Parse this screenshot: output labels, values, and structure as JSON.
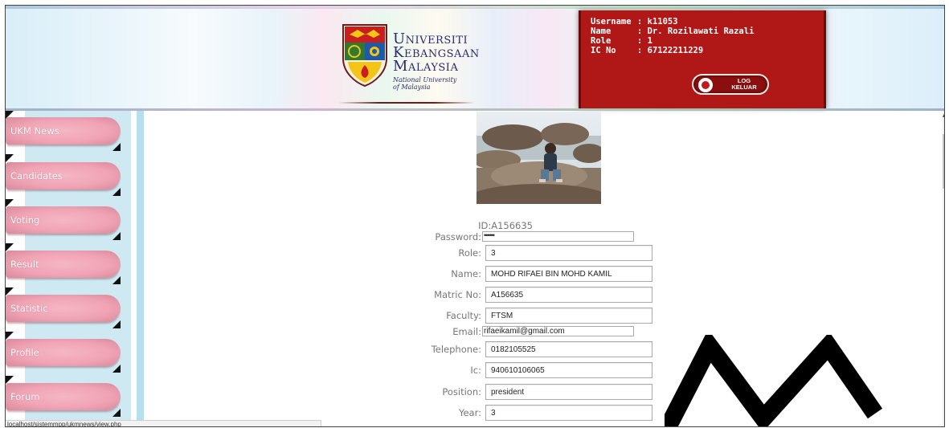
{
  "header": {
    "logo": {
      "line1_cap": "U",
      "line1_rest": "NIVERSITI",
      "line2_cap": "K",
      "line2_rest": "EBANGSAAN",
      "line3_cap": "M",
      "line3_rest": "ALAYSIA",
      "sub1": "National University",
      "sub2": "of Malaysia"
    },
    "user": {
      "username_label": "Username",
      "username_value": ": k11053",
      "name_label": "Name",
      "name_value": ": Dr. Rozilawati Razali",
      "role_label": "Role",
      "role_value": ": 1",
      "ic_label": "IC No",
      "ic_value": ": 67122211229"
    },
    "logout": {
      "line1": "LOG",
      "line2": "KELUAR"
    }
  },
  "sidebar": {
    "items": [
      {
        "label": "UKM News"
      },
      {
        "label": "Candidates"
      },
      {
        "label": "Voting"
      },
      {
        "label": "Result"
      },
      {
        "label": "Statistic"
      },
      {
        "label": "Profile"
      },
      {
        "label": "Forum"
      }
    ]
  },
  "status_url": "localhost/sistemmpp/ukmnews/view.php",
  "profile": {
    "id_label": "ID:",
    "id_value": "A156635",
    "password_label": "Password:",
    "password_value": "••••••",
    "role_label": "Role:",
    "role_value": "3",
    "name_label": "Name:",
    "name_value": "MOHD RIFAEI BIN MOHD KAMIL",
    "matric_label": "Matric No:",
    "matric_value": "A156635",
    "faculty_label": "Faculty:",
    "faculty_value": "FTSM",
    "email_label": "Email:",
    "email_value": "rifaeikamil@gmail.com",
    "telephone_label": "Telephone:",
    "telephone_value": "0182105525",
    "ic_label": "Ic:",
    "ic_value": "940610106065",
    "position_label": "Position:",
    "position_value": "president",
    "year_label": "Year:",
    "year_value": "3"
  },
  "colors": {
    "user_panel": "#b01818",
    "nav_pill": "#f0a4b5",
    "sidebar_column": "#cfe9f3",
    "label_text": "#777777"
  }
}
